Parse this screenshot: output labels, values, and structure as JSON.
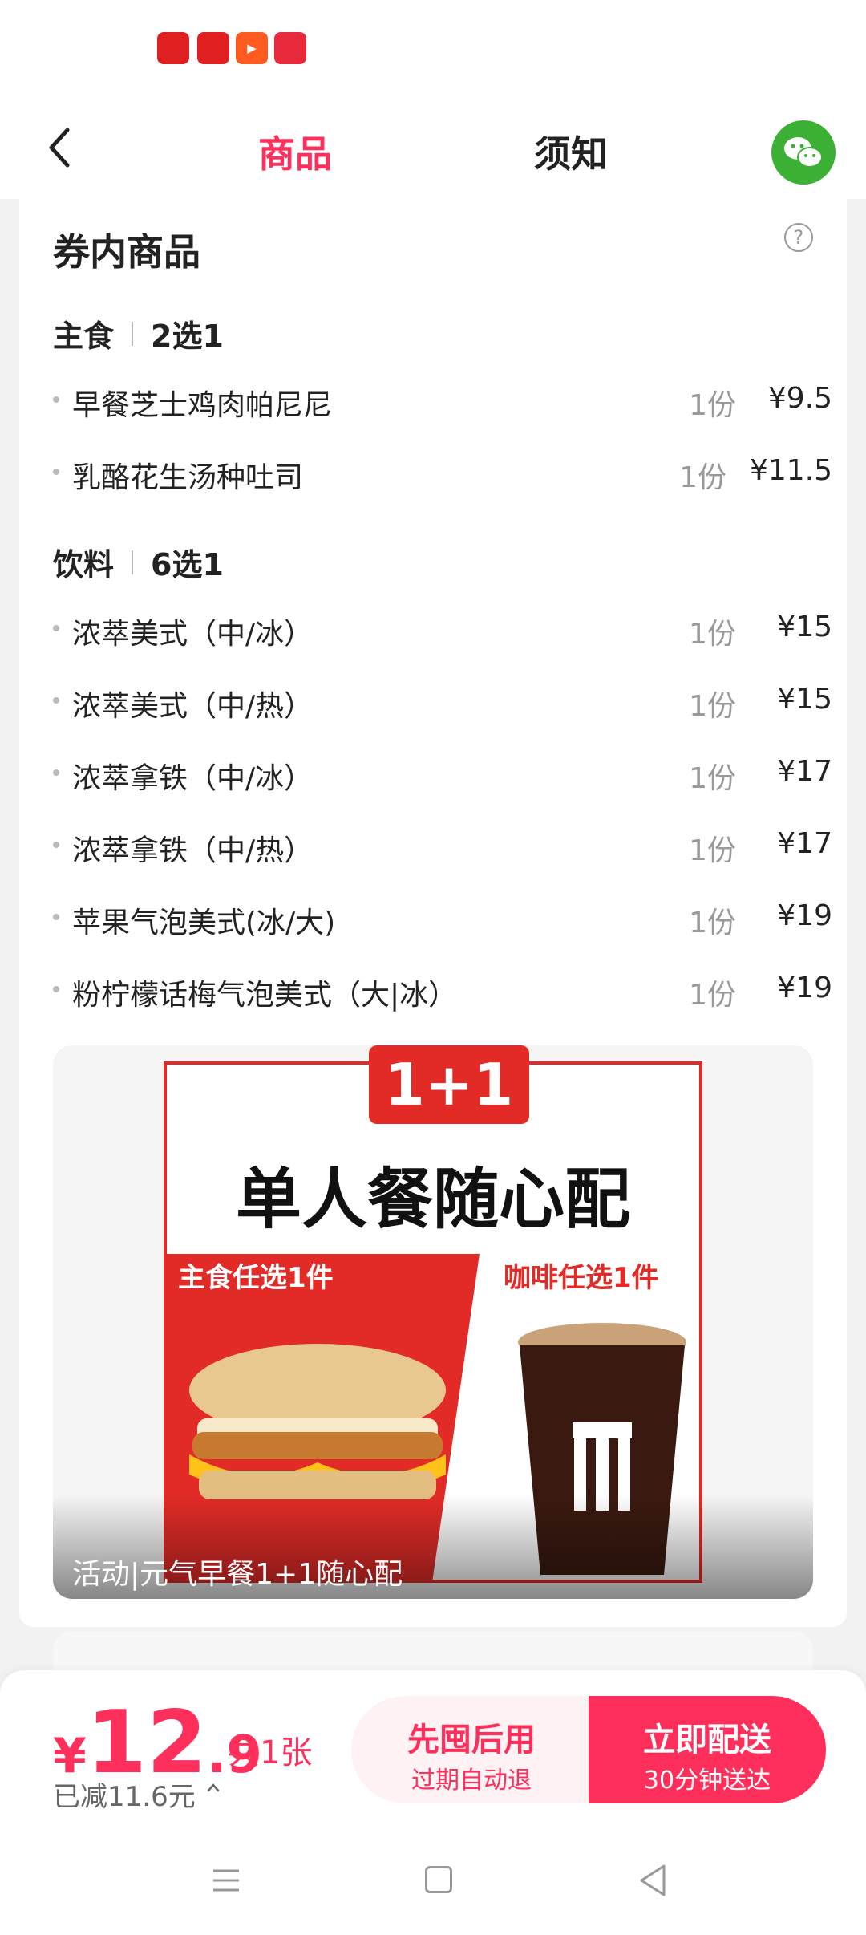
{
  "header": {
    "tabs": [
      {
        "label": "商品",
        "active": true
      },
      {
        "label": "须知",
        "active": false
      }
    ]
  },
  "card": {
    "title": "券内商品",
    "groups": [
      {
        "name": "主食",
        "rule": "2选1",
        "items": [
          {
            "name": "早餐芝士鸡肉帕尼尼",
            "qty": "1份",
            "price": "¥9.5"
          },
          {
            "name": "乳酪花生汤种吐司",
            "qty": "1份",
            "price": "¥11.5"
          }
        ]
      },
      {
        "name": "饮料",
        "rule": "6选1",
        "items": [
          {
            "name": "浓萃美式（中/冰）",
            "qty": "1份",
            "price": "¥15"
          },
          {
            "name": "浓萃美式（中/热）",
            "qty": "1份",
            "price": "¥15"
          },
          {
            "name": "浓萃拿铁（中/冰）",
            "qty": "1份",
            "price": "¥17"
          },
          {
            "name": "浓萃拿铁（中/热）",
            "qty": "1份",
            "price": "¥17"
          },
          {
            "name": "苹果气泡美式(冰/大)",
            "qty": "1份",
            "price": "¥19"
          },
          {
            "name": "粉柠檬话梅气泡美式（大|冰）",
            "qty": "1份",
            "price": "¥19"
          }
        ]
      }
    ],
    "promo": {
      "badge": "1+1",
      "title": "单人餐随心配",
      "left_label": "主食任选1件",
      "right_label": "咖啡任选1件",
      "caption": "活动|元气早餐1+1随心配"
    }
  },
  "bottom": {
    "currency": "¥",
    "price_int": "12",
    "price_dec": ".9",
    "count": "共1张",
    "reduced": "已减11.6元",
    "btn_left_title": "先囤后用",
    "btn_left_sub": "过期自动退",
    "btn_right_title": "立即配送",
    "btn_right_sub": "30分钟送达"
  },
  "colors": {
    "accent": "#ff2f5b",
    "promo_red": "#e22b27",
    "wechat_green": "#3cb034"
  },
  "icons": [
    "back-arrow-icon",
    "wechat-icon",
    "help-icon",
    "chevron-up-icon",
    "menu-icon",
    "home-icon",
    "nav-back-icon"
  ]
}
